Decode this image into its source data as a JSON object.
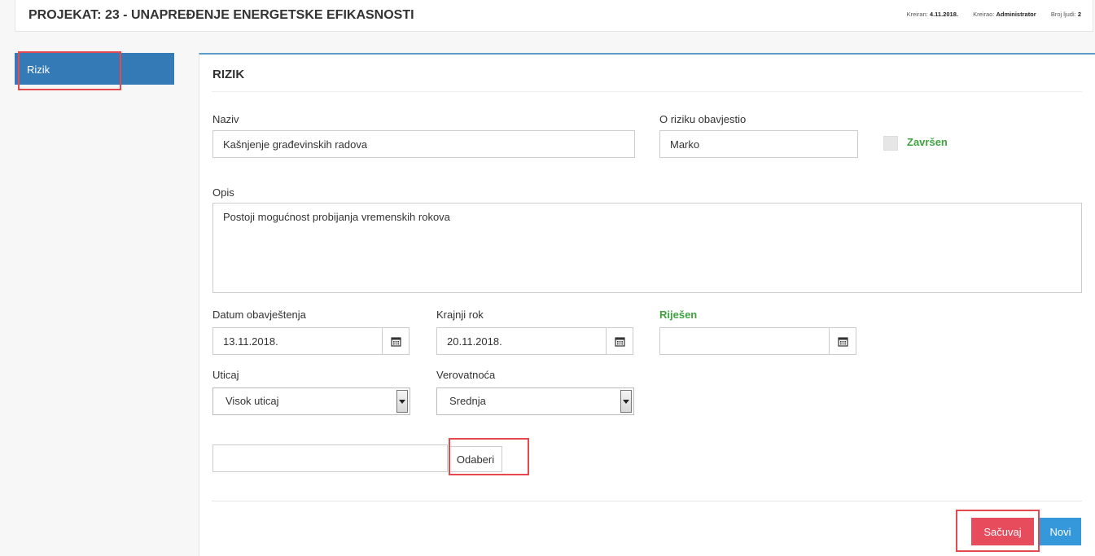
{
  "header": {
    "title": "PROJEKAT: 23 - UNAPREĐENJE ENERGETSKE EFIKASNOSTI",
    "created_label": "Kreiran:",
    "created_value": "4.11.2018.",
    "creator_label": "Kreirao:",
    "creator_value": "Administrator",
    "people_label": "Broj ljudi:",
    "people_value": "2"
  },
  "sidebar": {
    "items": [
      {
        "label": "Rizik"
      }
    ]
  },
  "form": {
    "title": "RIZIK",
    "name_label": "Naziv",
    "name_value": "Kašnjenje građevinskih radova",
    "reporter_label": "O riziku obavjestio",
    "reporter_value": "Marko",
    "done_label": "Završen",
    "description_label": "Opis",
    "description_value": "Postoji mogućnost probijanja vremenskih rokova",
    "notice_date_label": "Datum obavještenja",
    "notice_date_value": "13.11.2018.",
    "deadline_label": "Krajnji rok",
    "deadline_value": "20.11.2018.",
    "resolved_label": "Riješen",
    "resolved_value": "",
    "impact_label": "Uticaj",
    "impact_value": "Visok uticaj",
    "probability_label": "Verovatnoća",
    "probability_value": "Srednja",
    "file_value": "",
    "choose_label": "Odaberi",
    "save_label": "Sačuvaj",
    "new_label": "Novi"
  },
  "colors": {
    "accent": "#337ab7",
    "success": "#3ea33e",
    "danger": "#e74c5c",
    "primary": "#3498db",
    "highlight": "#e5484d"
  },
  "icons": [
    "calendar-icon",
    "chevron-down-icon"
  ]
}
